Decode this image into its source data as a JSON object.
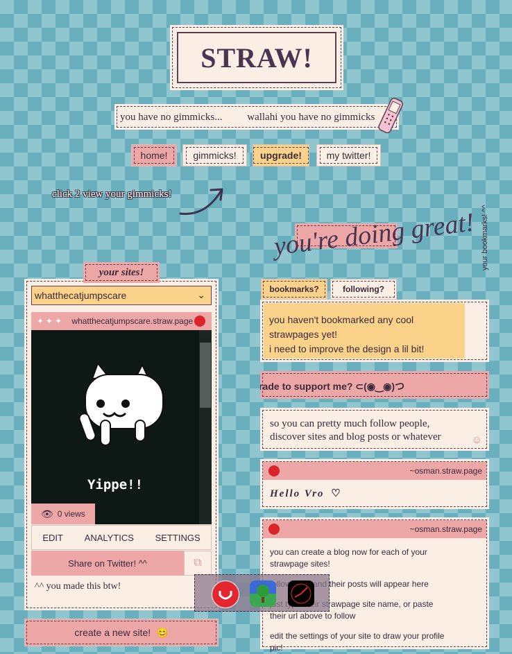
{
  "header": {
    "title": "STRAW!"
  },
  "marquee": {
    "items": [
      "you have no gimmicks...",
      "wallahi you have no gimmicks"
    ]
  },
  "nav": [
    {
      "label": "home!"
    },
    {
      "label": "gimmicks!"
    },
    {
      "label": "upgrade!"
    },
    {
      "label": "my twitter!"
    }
  ],
  "hint": {
    "text": "click 2 view your gimmicks!"
  },
  "banner": {
    "text": "you're doing great!"
  },
  "sites": {
    "tab_label": "your sites!",
    "selected_site": "whatthecatjumpscare",
    "preview_url": "whatthecatjumpscare.straw.page",
    "preview_caption": "Yippe!!",
    "views_label": "0 views",
    "actions": [
      "EDIT",
      "ANALYTICS",
      "SETTINGS"
    ],
    "share_label": "Share on Twitter! ^^",
    "made_note": "^^ you made this btw!",
    "create_label": "create a new site!"
  },
  "bookmarks": {
    "tab_bookmarks": "bookmarks?",
    "tab_following": "following?",
    "empty_line1": "you haven't bookmarked any cool strawpages yet!",
    "empty_line2": "i need to improve the design a lil bit!",
    "side_label": "your bookmarks! ^^"
  },
  "ticker": {
    "text": "wanna upgrade to support me? ⊂(◉‿◉)つ"
  },
  "follow_info": {
    "line1": "so you can pretty much follow people,",
    "line2": "discover sites and blog posts or whatever"
  },
  "posts": [
    {
      "author": "~osman.straw.page",
      "body": "Hello Vro"
    },
    {
      "author": "~osman.straw.page",
      "lines": [
        "you can create a blog now for each of your strawpage sites!",
        "follow sites and their posts will appear here",
        "just type their strawpage site name, or paste their url above to follow",
        "edit the settings of your site to draw your profile pic!"
      ]
    }
  ],
  "dock": {
    "apps": [
      "smile-app",
      "landscape-app",
      "clock-app"
    ]
  }
}
